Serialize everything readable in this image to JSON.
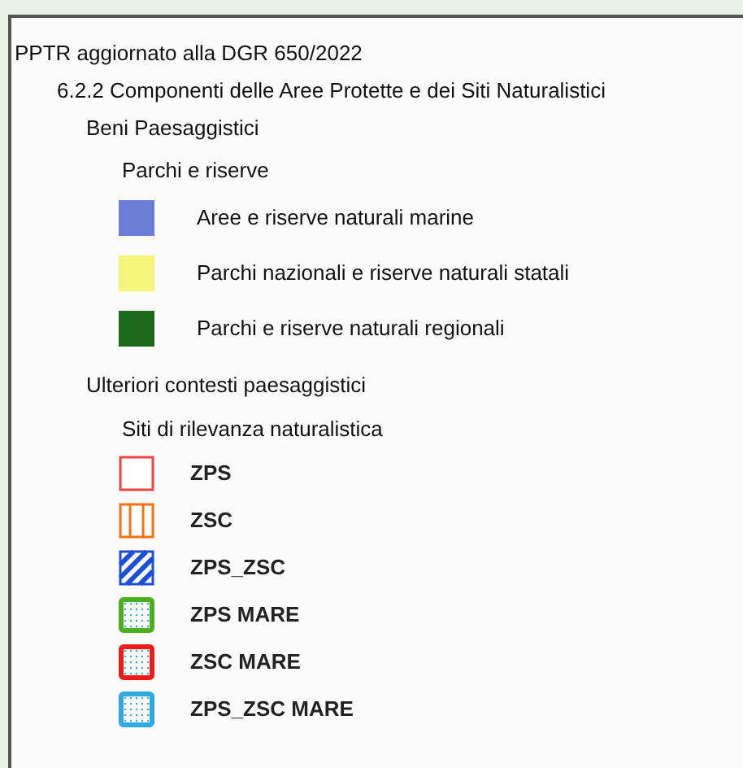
{
  "title": "PPTR aggiornato alla DGR 650/2022",
  "subtitle": "6.2.2 Componenti delle Aree Protette e dei Siti Naturalistici",
  "groups": [
    {
      "label": "Beni Paesaggistici",
      "sections": [
        {
          "label": "Parchi e riserve",
          "items": [
            {
              "label": "Aree e riserve naturali marine",
              "kind": "fill",
              "color": "#6b7fd7",
              "bold": false
            },
            {
              "label": "Parchi nazionali e riserve naturali statali",
              "kind": "fill",
              "color": "#f5f57a",
              "bold": false
            },
            {
              "label": "Parchi e riserve naturali regionali",
              "kind": "fill",
              "color": "#1c6b1c",
              "bold": false
            }
          ]
        }
      ]
    },
    {
      "label": "Ulteriori contesti paesaggistici",
      "sections": [
        {
          "label": "Siti di rilevanza naturalistica",
          "items": [
            {
              "label": "ZPS",
              "kind": "outline",
              "color": "#ef4444",
              "bold": true
            },
            {
              "label": "ZSC",
              "kind": "columns",
              "color": "#f97316",
              "bold": true
            },
            {
              "label": "ZPS_ZSC",
              "kind": "stripes",
              "color": "#1d4ed8",
              "bold": true
            },
            {
              "label": "ZPS MARE",
              "kind": "dots",
              "color": "#4caf1f",
              "bold": true
            },
            {
              "label": "ZSC MARE",
              "kind": "dots",
              "color": "#f01b1b",
              "bold": true
            },
            {
              "label": "ZPS_ZSC MARE",
              "kind": "dots",
              "color": "#2fa8e0",
              "bold": true
            }
          ]
        }
      ]
    }
  ]
}
